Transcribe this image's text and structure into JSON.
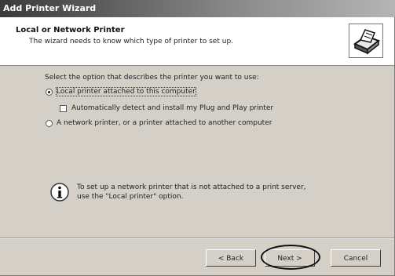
{
  "window": {
    "title": "Add Printer Wizard"
  },
  "header": {
    "title": "Local or Network Printer",
    "subtitle": "The wizard needs to know which type of printer to set up.",
    "icon": "printer-icon"
  },
  "body": {
    "prompt": "Select the option that describes the printer you want to use:",
    "options": [
      {
        "label": "Local printer attached to this computer",
        "selected": true
      },
      {
        "label": "A network printer, or a printer attached to another computer",
        "selected": false
      }
    ],
    "auto_detect": {
      "label": "Automatically detect and install my Plug and Play printer",
      "checked": false
    },
    "info_icon": "info-icon",
    "info_line1": "To set up a network printer that is not attached to a print server,",
    "info_line2": "use the \"Local printer\" option."
  },
  "buttons": {
    "back": "< Back",
    "next": "Next >",
    "cancel": "Cancel"
  },
  "colors": {
    "dialog_bg": "#d4d0c8",
    "header_bg": "#ffffff",
    "title_bar": "#3a3a3a"
  }
}
